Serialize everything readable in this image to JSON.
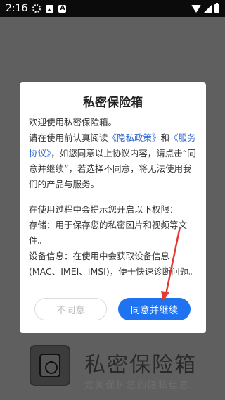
{
  "status_bar": {
    "time": "2:16",
    "icons": [
      "settings-icon",
      "image-icon",
      "a-badge-icon",
      "wifi-icon",
      "signal-icon",
      "battery-icon"
    ],
    "a_badge": "A"
  },
  "dialog": {
    "title": "私密保险箱",
    "welcome": "欢迎使用私密保险箱。",
    "intro_prefix": "请在使用前认真阅读",
    "privacy_link": "《隐私政策》",
    "intro_and": "和",
    "service_link": "《服务协议》",
    "intro_suffix": "，如您同意以上协议内容，请点击“同意并继续”，若选择不同意，将无法使用我们的产品与服务。",
    "permissions_intro": "在使用过程中会提示您开启以下权限：",
    "storage": "存储：用于保存您的私密图片和视频等文件。",
    "device_info": "设备信息：在使用中会获取设备信息(MAC、IMEI、IMSI)，便于快速诊断问题。",
    "disagree_label": "不同意",
    "agree_label": "同意并继续"
  },
  "brand": {
    "name": "私密保险箱",
    "slogan": "完美保护您的隐私信息"
  },
  "colors": {
    "accent": "#1f73f0",
    "link": "#2d69d4",
    "overlay": "#5f5f5f",
    "arrow": "#e53935"
  }
}
